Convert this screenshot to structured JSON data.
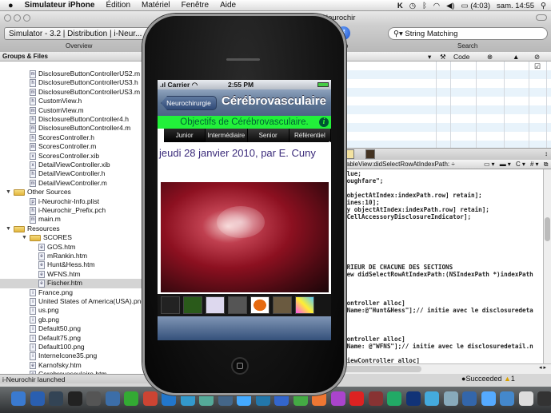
{
  "menubar": {
    "apple": "",
    "app": "Simulateur iPhone",
    "items": [
      "Édition",
      "Matériel",
      "Fenêtre",
      "Aide"
    ],
    "battery": "(4:03)",
    "clock": "sam. 14:55",
    "status_icons": [
      "k-icon",
      "time-machine-icon",
      "bluetooth-icon",
      "wifi-icon",
      "volume-icon",
      "battery-icon",
      "spotlight-icon"
    ]
  },
  "window": {
    "title": "i-Neurochir",
    "scheme": "Simulator - 3.2 | Distribution | i-Neur...",
    "overview": "Overview",
    "info": "Info",
    "search_placeholder": "String Matching",
    "search_label": "Search"
  },
  "groups": {
    "header": "Groups & Files",
    "items": [
      {
        "label": "DisclosureButtonControllerUS2.m",
        "type": "m",
        "level": 2
      },
      {
        "label": "DisclosureButtonControllerUS3.h",
        "type": "h",
        "level": 2
      },
      {
        "label": "DisclosureButtonControllerUS3.m",
        "type": "m",
        "level": 2
      },
      {
        "label": "CustomView.h",
        "type": "h",
        "level": 2
      },
      {
        "label": "CustomView.m",
        "type": "m",
        "level": 2
      },
      {
        "label": "DisclosureButtonController4.h",
        "type": "h",
        "level": 2
      },
      {
        "label": "DisclosureButtonController4.m",
        "type": "m",
        "level": 2
      },
      {
        "label": "ScoresController.h",
        "type": "h",
        "level": 2
      },
      {
        "label": "ScoresController.m",
        "type": "m",
        "level": 2
      },
      {
        "label": "ScoresController.xib",
        "type": "x",
        "level": 2
      },
      {
        "label": "DetailViewController.xib",
        "type": "x",
        "level": 2
      },
      {
        "label": "DetailViewController.h",
        "type": "h",
        "level": 2
      },
      {
        "label": "DetailViewController.m",
        "type": "m",
        "level": 2
      },
      {
        "label": "Other Sources",
        "type": "folder",
        "level": 1
      },
      {
        "label": "i-Neurochir-Info.plist",
        "type": "p",
        "level": 2
      },
      {
        "label": "i-Neurochir_Prefix.pch",
        "type": "h",
        "level": 2
      },
      {
        "label": "main.m",
        "type": "m",
        "level": 2
      },
      {
        "label": "Resources",
        "type": "folder",
        "level": 1
      },
      {
        "label": "SCORES",
        "type": "folder",
        "level": 2
      },
      {
        "label": "GOS.htm",
        "type": "e",
        "level": 3
      },
      {
        "label": "mRankin.htm",
        "type": "e",
        "level": 3
      },
      {
        "label": "Hunt&Hess.htm",
        "type": "e",
        "level": 3
      },
      {
        "label": "WFNS.htm",
        "type": "e",
        "level": 3
      },
      {
        "label": "Fischer.htm",
        "type": "e",
        "level": 3,
        "selected": true
      },
      {
        "label": "France.png",
        "type": "i",
        "level": 2
      },
      {
        "label": "United States of America(USA).png",
        "type": "i",
        "level": 2
      },
      {
        "label": "us.png",
        "type": "i",
        "level": 2
      },
      {
        "label": "gb.png",
        "type": "i",
        "level": 2
      },
      {
        "label": "Default50.png",
        "type": "i",
        "level": 2
      },
      {
        "label": "Default75.png",
        "type": "i",
        "level": 2
      },
      {
        "label": "Default100.png",
        "type": "i",
        "level": 2
      },
      {
        "label": "InterneIcone35.png",
        "type": "i",
        "level": 2
      },
      {
        "label": "Karnofsky.htm",
        "type": "e",
        "level": 2
      },
      {
        "label": "Cerebrovasculaire.htm",
        "type": "e",
        "level": 2
      },
      {
        "label": "Cerebrovascular.htm",
        "type": "e",
        "level": 2
      }
    ]
  },
  "status_left": "i-Neurochir launched",
  "table": {
    "columns": [
      "",
      "",
      "Code",
      "",
      "",
      ""
    ],
    "col_icons": [
      "hammer-icon",
      "error-icon",
      "warning-icon",
      "checkbox-icon"
    ]
  },
  "editor": {
    "function_popup": "-tableView:didSelectRowAtIndexPath: ÷",
    "lines": [
      {
        "n": 0,
        "t": "alue;"
      },
      {
        "n": 1,
        "t": "roughfare\";"
      },
      {
        "n": 3,
        "t": " objectAtIndex:indexPath.row] retain];"
      },
      {
        "n": 4,
        "t": "Lines:10];"
      },
      {
        "n": 5,
        "t": "ay objectAtIndex:indexPath.row] retain];"
      },
      {
        "n": 6,
        "t": "wCellAccessoryDisclosureIndicator];"
      },
      {
        "n": 13,
        "t": "ERIEUR DE CHACUNE DES SECTIONS"
      },
      {
        "n": 14,
        "t": "iew didSelectRowAtIndexPath:(NSIndexPath *)indexPath"
      },
      {
        "n": 18,
        "t": "Controller alloc]"
      },
      {
        "n": 19,
        "t": "eName:@\"Hunt&Hess\"];// initie avec le disclosuredeta"
      },
      {
        "n": 23,
        "t": "Controller alloc]"
      },
      {
        "n": 24,
        "t": "eName: @\"WFNS\"];// initie avec le disclosuredetail.n"
      },
      {
        "n": 26,
        "t": "ViewController alloc]"
      }
    ],
    "status": "Succeeded",
    "warnings": "1"
  },
  "phone": {
    "carrier": "Carrier",
    "time": "2:55 PM",
    "back": "Neurochirurgie",
    "title": "Cérébrovasculaire",
    "banner": "Objectifs de Cérébrovasculaire.",
    "segments": [
      "Junior",
      "Intermédiaire",
      "Senior",
      "Référentiel"
    ],
    "date": "jeudi 28 janvier 2010, par E. Cuny"
  },
  "colors": {
    "banner": "#22f03a",
    "accent": "#1a4fc9"
  }
}
